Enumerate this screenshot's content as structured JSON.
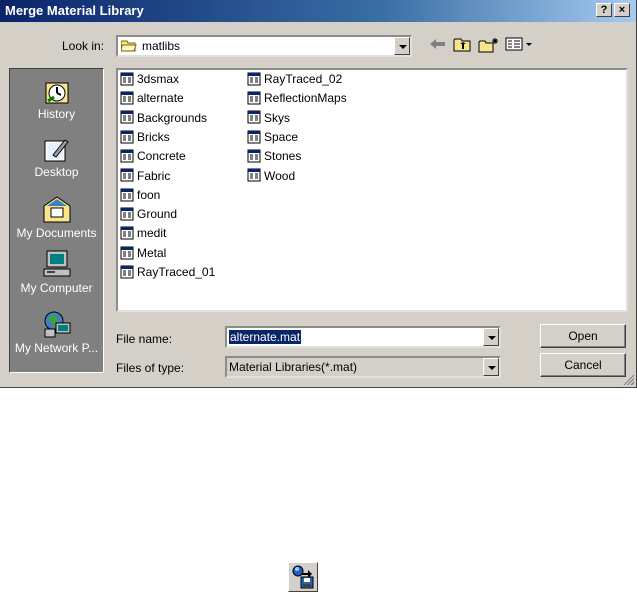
{
  "window": {
    "title": "Merge Material Library",
    "help_button": "?",
    "close_button": "×"
  },
  "lookin": {
    "label": "Look in:",
    "value": "matlibs"
  },
  "toolbar": {
    "back_icon": "back-arrow-icon",
    "up_icon": "up-folder-icon",
    "new_folder_icon": "new-folder-icon",
    "views_icon": "views-menu-icon"
  },
  "places": [
    {
      "label": "History",
      "icon": "history-icon"
    },
    {
      "label": "Desktop",
      "icon": "desktop-icon"
    },
    {
      "label": "My Documents",
      "icon": "my-documents-icon"
    },
    {
      "label": "My Computer",
      "icon": "my-computer-icon"
    },
    {
      "label": "My Network P...",
      "icon": "my-network-places-icon"
    }
  ],
  "files": {
    "col1": [
      "3dsmax",
      "alternate",
      "Backgrounds",
      "Bricks",
      "Concrete",
      "Fabric",
      "foon",
      "Ground",
      "medit",
      "Metal",
      "RayTraced_01"
    ],
    "col2": [
      "RayTraced_02",
      "ReflectionMaps",
      "Skys",
      "Space",
      "Stones",
      "Wood"
    ]
  },
  "filename": {
    "label": "File name:",
    "value": "alternate.mat"
  },
  "filetype": {
    "label": "Files of type:",
    "value": "Material Libraries(*.mat)"
  },
  "buttons": {
    "open": "Open",
    "cancel": "Cancel"
  },
  "bottom_toolbar_button": {
    "icon": "get-material-icon"
  },
  "colors": {
    "titlebar_start": "#0a246a",
    "titlebar_end": "#a6caf0",
    "dialog_face": "#d4d0c8",
    "places_bar": "#808080",
    "selection": "#0a246a"
  }
}
